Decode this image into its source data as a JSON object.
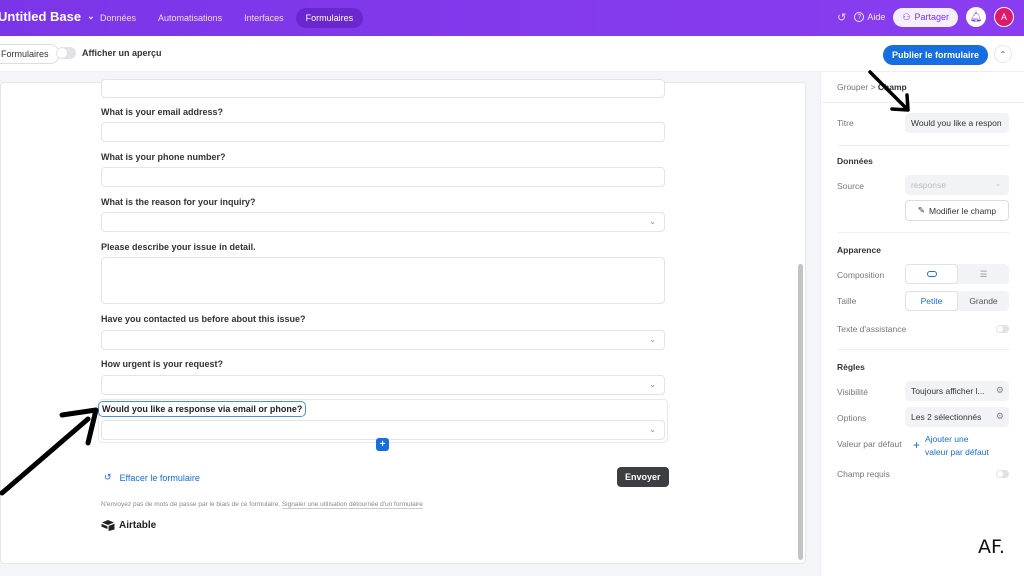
{
  "topbar": {
    "base_title": "Untitled Base",
    "nav": [
      "Données",
      "Automatisations",
      "Interfaces",
      "Formulaires"
    ],
    "active_nav": "Formulaires",
    "help_label": "Aide",
    "share_label": "Partager",
    "avatar_initial": "A"
  },
  "toolbar": {
    "forms_pill": "Formulaires",
    "preview_label": "Afficher un aperçu",
    "preview_on": false,
    "publish_label": "Publier le formulaire"
  },
  "form": {
    "fields": [
      {
        "label": "What is your email address?",
        "type": "text"
      },
      {
        "label": "What is your phone number?",
        "type": "text"
      },
      {
        "label": "What is the reason for your inquiry?",
        "type": "select"
      },
      {
        "label": "Please describe your issue in detail.",
        "type": "textarea"
      },
      {
        "label": "Have you contacted us before about this issue?",
        "type": "select"
      },
      {
        "label": "How urgent is your request?",
        "type": "select"
      },
      {
        "label": "Would you like a response via email or phone?",
        "type": "select",
        "selected": true
      }
    ],
    "add_icon": "+",
    "clear_label": "Effacer le formulaire",
    "send_label": "Envoyer",
    "disclaimer": "N'envoyez pas de mots de passe par le biais de ce formulaire.",
    "report_link": "Signaler une utilisation détournée d'un formulaire",
    "brand": "Airtable"
  },
  "panel": {
    "breadcrumb_parent": "Grouper",
    "breadcrumb_sep": ">",
    "breadcrumb_current": "Champ",
    "title_label": "Titre",
    "title_value": "Would you like a respon",
    "data_heading": "Données",
    "source_label": "Source",
    "source_value": "response",
    "edit_field_label": "Modifier le champ",
    "appearance_heading": "Apparence",
    "composition_label": "Composition",
    "size_label": "Taille",
    "size_options": [
      "Petite",
      "Grande"
    ],
    "size_selected": "Petite",
    "help_text_label": "Texte d'assistance",
    "help_text_on": false,
    "rules_heading": "Règles",
    "visibility_label": "Visibilité",
    "visibility_value": "Toujours afficher l...",
    "options_label": "Options",
    "options_value": "Les 2 sélectionnés",
    "default_label": "Valeur par défaut",
    "default_add_line1": "Ajouter une",
    "default_add_line2": "valeur par défaut",
    "required_label": "Champ requis",
    "required_on": false
  },
  "watermark": "AF.",
  "colors": {
    "topbar": "#7b35e8",
    "accent": "#166ee1",
    "send_button": "#3d3e42",
    "avatar": "#e0186c"
  }
}
